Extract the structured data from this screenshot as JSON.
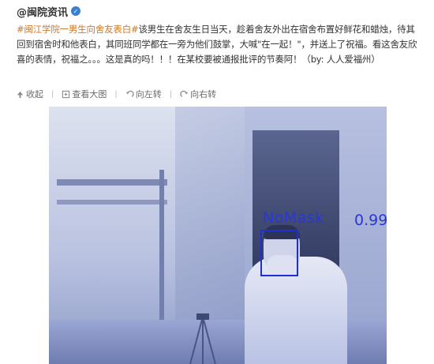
{
  "post": {
    "author": "@闽院资讯",
    "topic": "#闽江学院一男生向舍友表白#",
    "text": "该男生在舍友生日当天，趁着舍友外出在宿舍布置好鲜花和蜡烛，待其回到宿舍时和他表白，其同班同学都在一旁为他们鼓掌，大喊\"在一起！\"，并送上了祝福。看这舍友欣喜的表情，祝福之。。。这是真的吗！！！在某校要被通报批评的节奏阿！（by: 人人爱福州）",
    "actions": {
      "collapse": "收起",
      "view_large": "查看大图",
      "rotate_left": "向左转",
      "rotate_right": "向右转"
    }
  },
  "detection": {
    "label": "NoMask",
    "score": "0.99",
    "color": "#1f2fd6"
  }
}
